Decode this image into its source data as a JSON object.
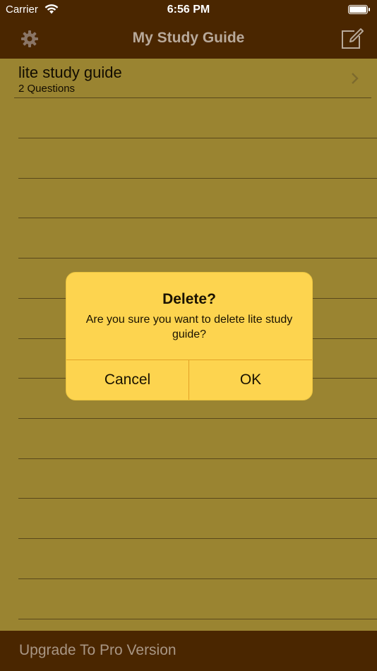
{
  "status_bar": {
    "carrier": "Carrier",
    "time": "6:56 PM"
  },
  "nav": {
    "title": "My Study Guide",
    "left_icon": "gear-icon",
    "right_icon": "compose-icon"
  },
  "list": {
    "items": [
      {
        "title": "lite study guide",
        "subtitle": "2 Questions"
      }
    ]
  },
  "bottom_bar": {
    "label": "Upgrade To Pro Version"
  },
  "alert": {
    "title": "Delete?",
    "message": "Are you sure you want to delete lite study guide?",
    "cancel_label": "Cancel",
    "ok_label": "OK"
  },
  "colors": {
    "bar_background": "#4a2600",
    "list_background": "#9a8431",
    "alert_background": "#fdd44f"
  }
}
